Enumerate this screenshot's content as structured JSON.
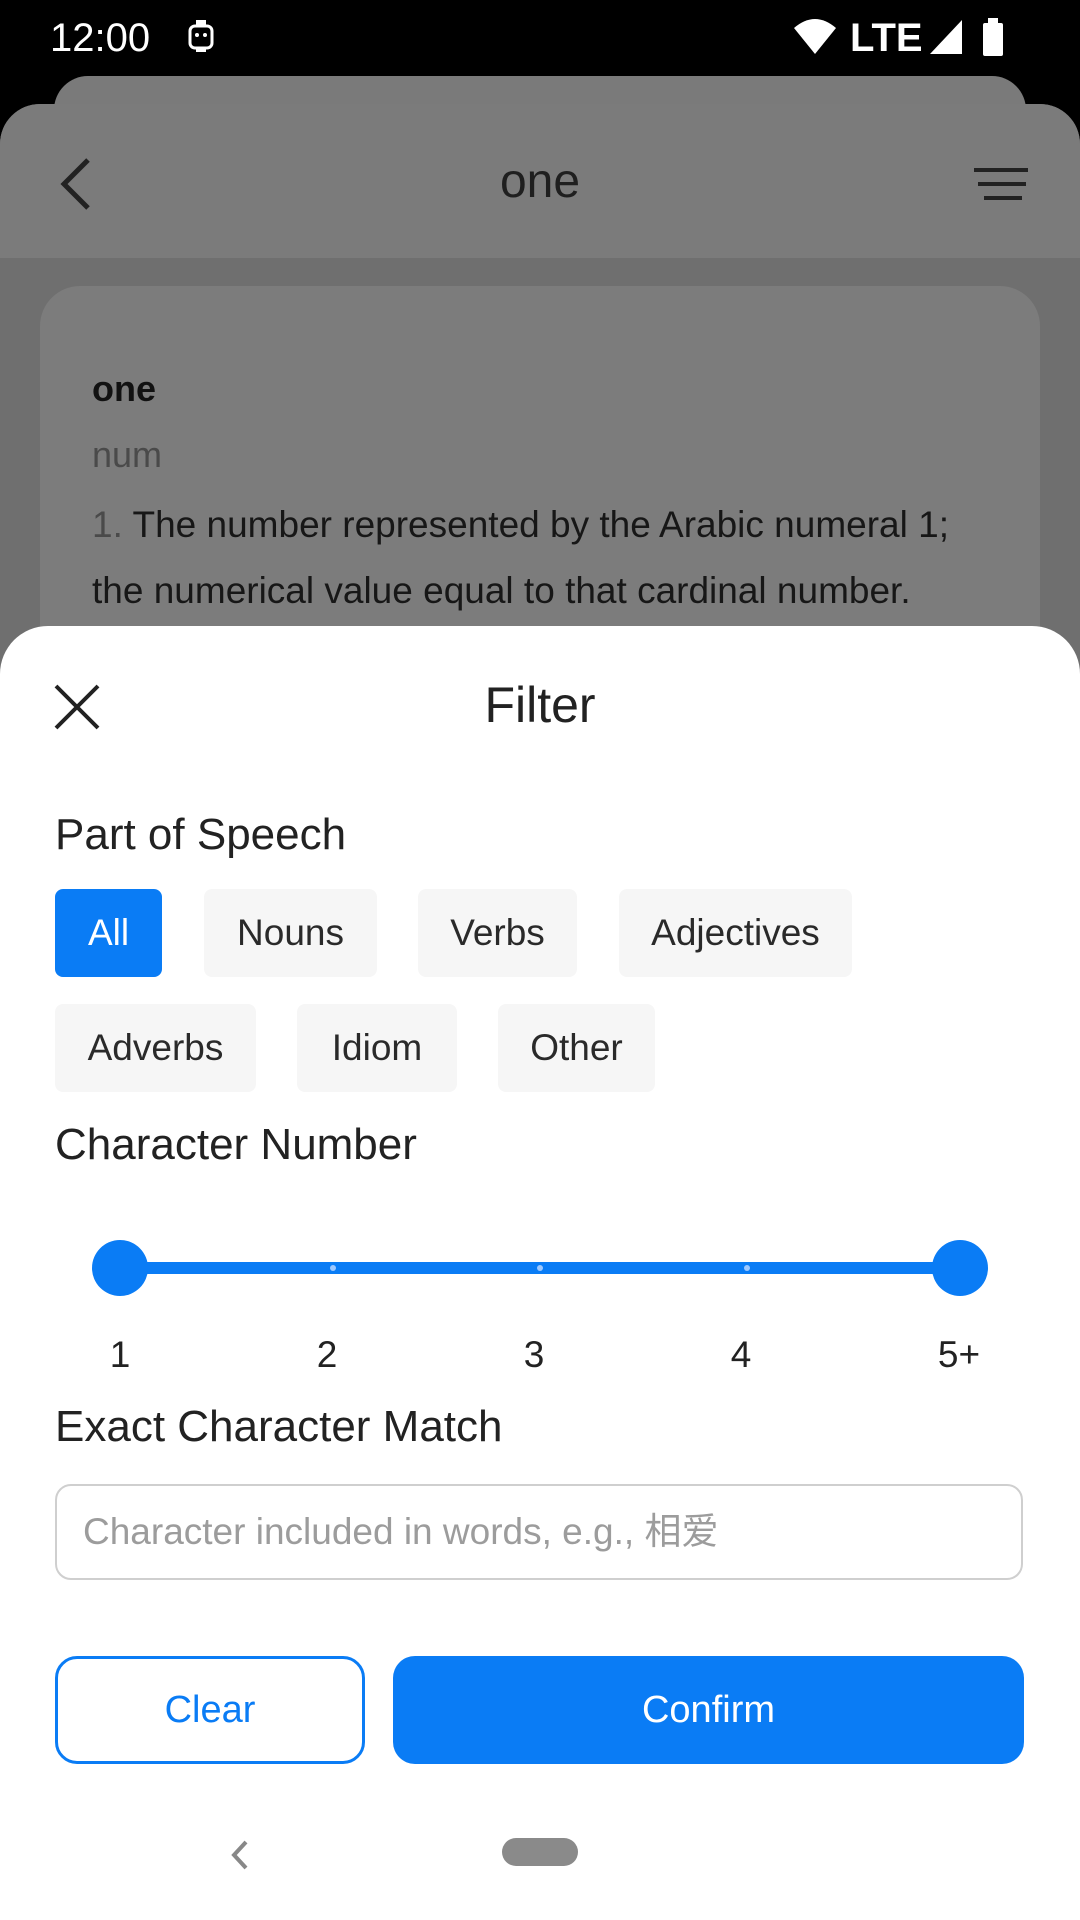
{
  "status_bar": {
    "time": "12:00",
    "network": "LTE"
  },
  "background_app": {
    "title": "one",
    "entry": {
      "word": "one",
      "part_of_speech": "num",
      "definition_number": "1.",
      "definition_text": "The number represented by the Arabic numeral 1; the numerical value equal to that cardinal number."
    }
  },
  "filter": {
    "title": "Filter",
    "part_of_speech_label": "Part of Speech",
    "chips": [
      "All",
      "Nouns",
      "Verbs",
      "Adjectives",
      "Adverbs",
      "Idiom",
      "Other"
    ],
    "selected_chip": "All",
    "character_number_label": "Character Number",
    "slider": {
      "ticks": [
        "1",
        "2",
        "3",
        "4",
        "5+"
      ],
      "range_start": "1",
      "range_end": "5+"
    },
    "exact_match_label": "Exact Character Match",
    "input_placeholder": "Character included in words, e.g., 相爱",
    "input_value": "",
    "clear_label": "Clear",
    "confirm_label": "Confirm"
  },
  "colors": {
    "accent": "#0a7cf5",
    "chip_bg": "#f6f6f6",
    "scrim": "#6f6f6f"
  }
}
